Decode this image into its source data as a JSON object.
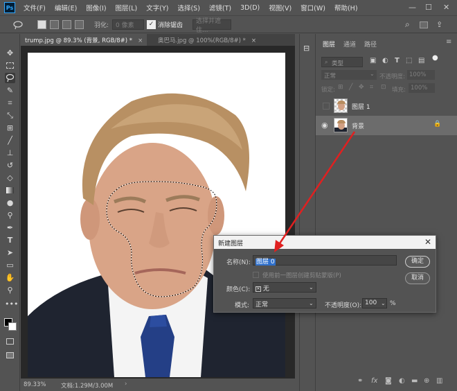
{
  "app": {
    "logo": "Ps"
  },
  "menu": [
    "文件(F)",
    "编辑(E)",
    "图像(I)",
    "图层(L)",
    "文字(Y)",
    "选择(S)",
    "滤镜(T)",
    "3D(D)",
    "视图(V)",
    "窗口(W)",
    "帮助(H)"
  ],
  "window_controls": {
    "minimize": "—",
    "maximize": "☐",
    "close": "✕"
  },
  "options": {
    "feather_label": "羽化:",
    "feather_value": "0 像素",
    "antialias_label": "消除锯齿",
    "select_subject_label": "选择并遮住..."
  },
  "tabs": [
    {
      "label": "trump.jpg @ 89.3% (背景, RGB/8#) *",
      "close": "×"
    },
    {
      "label": "奥巴马.jpg @ 100%(RGB/8#) *",
      "close": "×"
    }
  ],
  "status": {
    "zoom": "89.33%",
    "doc": "文档:1.29M/3.00M"
  },
  "layers_panel": {
    "tabs": [
      "图层",
      "通道",
      "路径"
    ],
    "search_placeholder": "类型",
    "blend_mode": "正常",
    "opacity_label": "不透明度:",
    "opacity_value": "100%",
    "lock_label": "锁定:",
    "fill_label": "填充:",
    "fill_value": "100%",
    "layers": [
      {
        "name": "图层 1",
        "visible": false,
        "selected": false
      },
      {
        "name": "背景",
        "visible": true,
        "selected": true,
        "locked": true
      }
    ]
  },
  "dialog": {
    "title": "新建图层",
    "name_label": "名称(N):",
    "name_value": "图层 0",
    "clip_label": "使用前一图层创建剪贴蒙版(P)",
    "color_label": "颜色(C):",
    "color_value": "无",
    "mode_label": "模式:",
    "mode_value": "正常",
    "opacity_label": "不透明度(O):",
    "opacity_value": "100",
    "opacity_unit": "%",
    "ok_label": "确定",
    "cancel_label": "取消"
  },
  "colors": {
    "accent": "#e02020",
    "selection": "#2e6fcb"
  }
}
